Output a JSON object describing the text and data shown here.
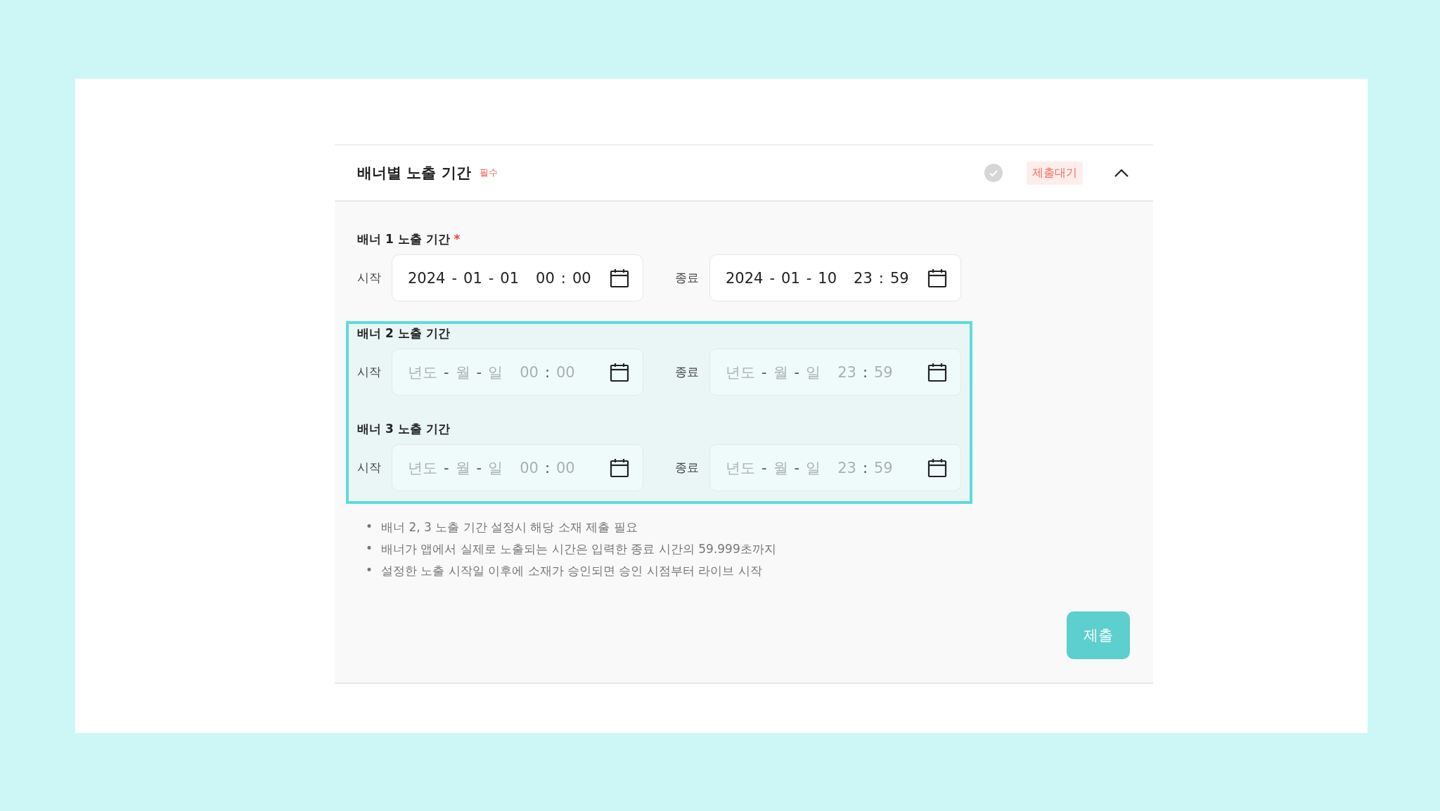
{
  "section": {
    "title": "배너별 노출 기간",
    "required_tag": "필수",
    "completed": false,
    "status": "제출대기",
    "expanded": true
  },
  "banner_groups": [
    {
      "highlighted": false,
      "banners": [
        {
          "title": "배너 1 노출 기간",
          "required_mark": "*",
          "fields": [
            {
              "label": "시작",
              "empty": false,
              "segments": [
                {
                  "kind": "year",
                  "text": "2024"
                },
                {
                  "kind": "sep",
                  "text": "-"
                },
                {
                  "kind": "month",
                  "text": "01"
                },
                {
                  "kind": "sep",
                  "text": "-"
                },
                {
                  "kind": "day",
                  "text": "01"
                },
                {
                  "kind": "hour",
                  "text": "00"
                },
                {
                  "kind": "sep",
                  "text": ":"
                },
                {
                  "kind": "minute",
                  "text": "00"
                }
              ]
            },
            {
              "label": "종료",
              "empty": false,
              "segments": [
                {
                  "kind": "year",
                  "text": "2024"
                },
                {
                  "kind": "sep",
                  "text": "-"
                },
                {
                  "kind": "month",
                  "text": "01"
                },
                {
                  "kind": "sep",
                  "text": "-"
                },
                {
                  "kind": "day",
                  "text": "10"
                },
                {
                  "kind": "hour",
                  "text": "23"
                },
                {
                  "kind": "sep",
                  "text": ":"
                },
                {
                  "kind": "minute",
                  "text": "59"
                }
              ]
            }
          ]
        }
      ]
    },
    {
      "highlighted": true,
      "banners": [
        {
          "title": "배너 2 노출 기간",
          "fields": [
            {
              "label": "시작",
              "empty": true,
              "segments": [
                {
                  "kind": "year",
                  "text": "년도"
                },
                {
                  "kind": "sep",
                  "text": "-"
                },
                {
                  "kind": "month",
                  "text": "월"
                },
                {
                  "kind": "sep",
                  "text": "-"
                },
                {
                  "kind": "day",
                  "text": "일"
                },
                {
                  "kind": "hour",
                  "text": "00"
                },
                {
                  "kind": "sep",
                  "text": ":"
                },
                {
                  "kind": "minute",
                  "text": "00"
                }
              ]
            },
            {
              "label": "종료",
              "empty": true,
              "segments": [
                {
                  "kind": "year",
                  "text": "년도"
                },
                {
                  "kind": "sep",
                  "text": "-"
                },
                {
                  "kind": "month",
                  "text": "월"
                },
                {
                  "kind": "sep",
                  "text": "-"
                },
                {
                  "kind": "day",
                  "text": "일"
                },
                {
                  "kind": "hour",
                  "text": "23"
                },
                {
                  "kind": "sep",
                  "text": ":"
                },
                {
                  "kind": "minute",
                  "text": "59"
                }
              ]
            }
          ]
        },
        {
          "title": "배너 3 노출 기간",
          "fields": [
            {
              "label": "시작",
              "empty": true,
              "segments": [
                {
                  "kind": "year",
                  "text": "년도"
                },
                {
                  "kind": "sep",
                  "text": "-"
                },
                {
                  "kind": "month",
                  "text": "월"
                },
                {
                  "kind": "sep",
                  "text": "-"
                },
                {
                  "kind": "day",
                  "text": "일"
                },
                {
                  "kind": "hour",
                  "text": "00"
                },
                {
                  "kind": "sep",
                  "text": ":"
                },
                {
                  "kind": "minute",
                  "text": "00"
                }
              ]
            },
            {
              "label": "종료",
              "empty": true,
              "segments": [
                {
                  "kind": "year",
                  "text": "년도"
                },
                {
                  "kind": "sep",
                  "text": "-"
                },
                {
                  "kind": "month",
                  "text": "월"
                },
                {
                  "kind": "sep",
                  "text": "-"
                },
                {
                  "kind": "day",
                  "text": "일"
                },
                {
                  "kind": "hour",
                  "text": "23"
                },
                {
                  "kind": "sep",
                  "text": ":"
                },
                {
                  "kind": "minute",
                  "text": "59"
                }
              ]
            }
          ]
        }
      ]
    }
  ],
  "notes": [
    {
      "bullet": "•",
      "text": "배너 2, 3 노출 기간 설정시 해당 소재 제출 필요"
    },
    {
      "bullet": "•",
      "text": "배너가 앱에서 실제로 노출되는 시간은 입력한 종료 시간의 59.999초까지"
    },
    {
      "bullet": "•",
      "text": "설정한 노출 시작일 이후에 소재가 승인되면 승인 시점부터 라이브 시작"
    }
  ],
  "submit_button": "제출"
}
